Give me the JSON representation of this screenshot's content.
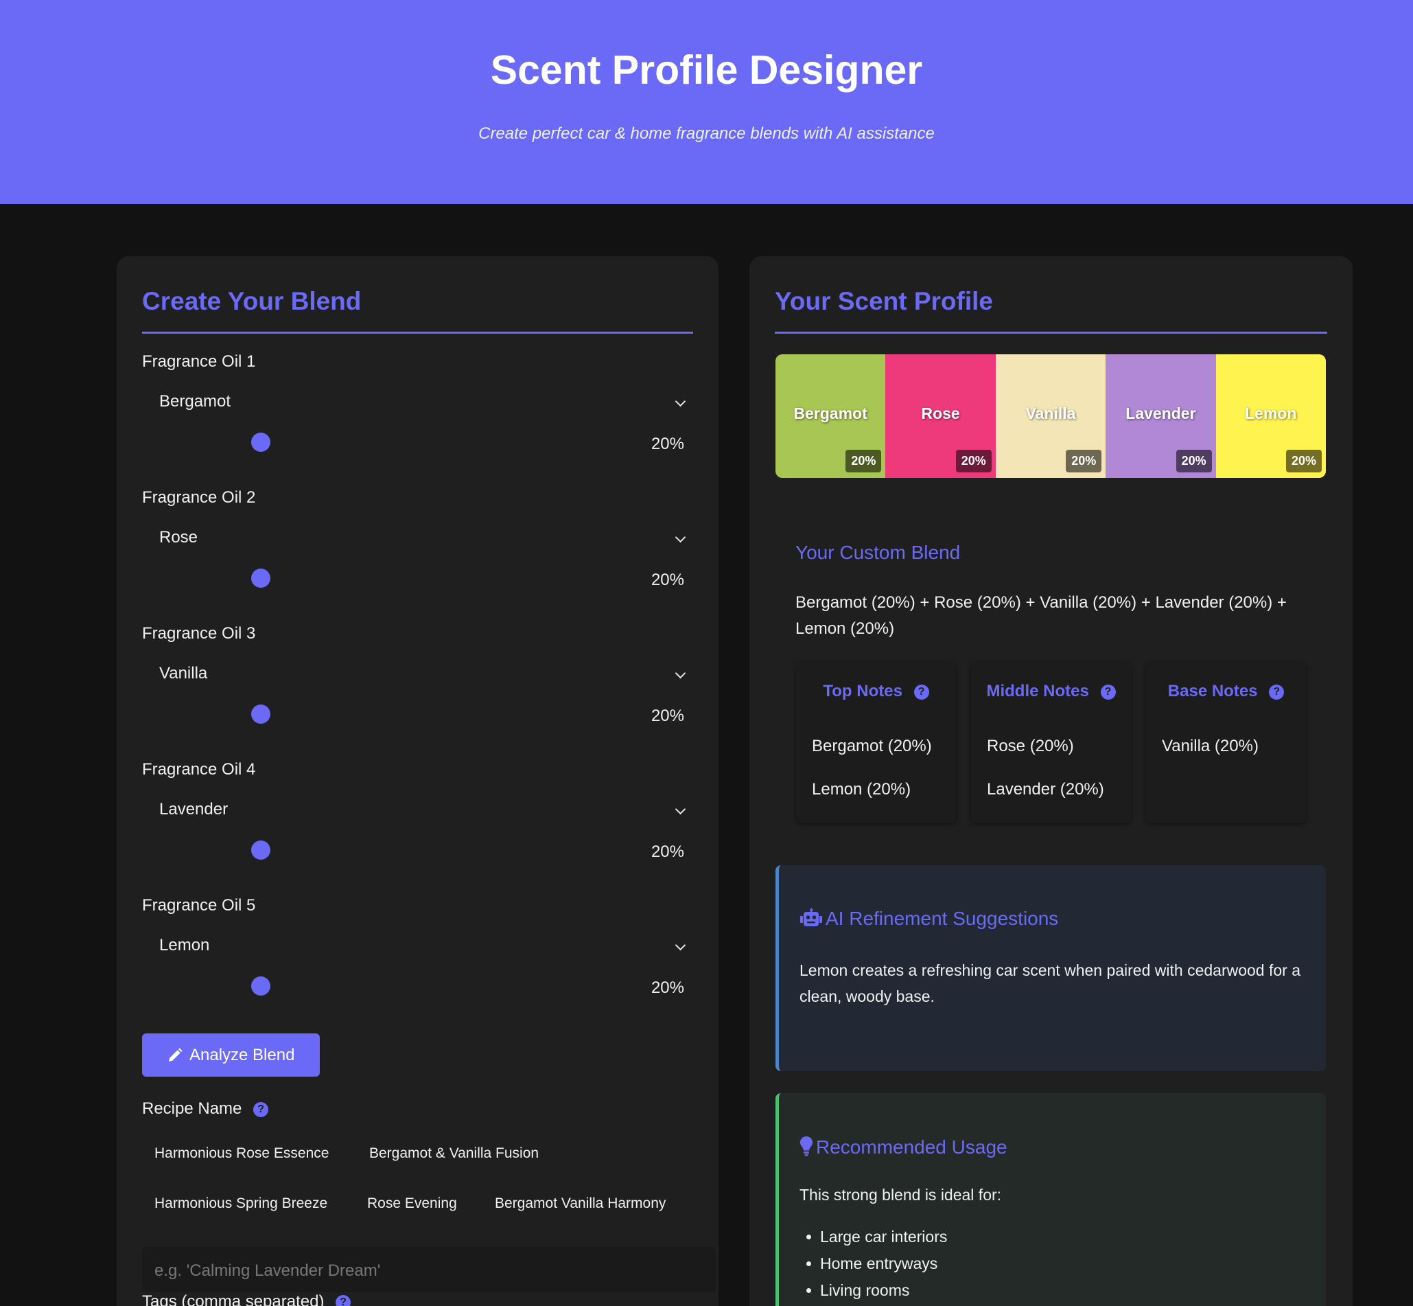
{
  "header": {
    "title": "Scent Profile Designer",
    "subtitle": "Create perfect car & home fragrance blends with AI assistance"
  },
  "colors": {
    "accent": "#6a6af6",
    "background": "#121212",
    "panel": "#1f1f1f"
  },
  "create_blend": {
    "title": "Create Your Blend",
    "oils": [
      {
        "label": "Fragrance Oil 1",
        "selected": "Bergamot",
        "percent_text": "20%",
        "slider_fraction": 0.2
      },
      {
        "label": "Fragrance Oil 2",
        "selected": "Rose",
        "percent_text": "20%",
        "slider_fraction": 0.2
      },
      {
        "label": "Fragrance Oil 3",
        "selected": "Vanilla",
        "percent_text": "20%",
        "slider_fraction": 0.2
      },
      {
        "label": "Fragrance Oil 4",
        "selected": "Lavender",
        "percent_text": "20%",
        "slider_fraction": 0.2
      },
      {
        "label": "Fragrance Oil 5",
        "selected": "Lemon",
        "percent_text": "20%",
        "slider_fraction": 0.2
      }
    ],
    "analyze_button": "Analyze Blend",
    "analyze_icon": "pencil-icon",
    "recipe_label": "Recipe Name",
    "help_glyph": "?",
    "recipe_suggestions": [
      "Harmonious Rose Essence",
      "Bergamot & Vanilla Fusion",
      "Harmonious Spring Breeze",
      "Rose Evening",
      "Bergamot Vanilla Harmony"
    ],
    "recipe_placeholder": "e.g. 'Calming Lavender Dream'",
    "tags_label": "Tags (comma separated)"
  },
  "scent_profile": {
    "title": "Your Scent Profile",
    "segments": [
      {
        "name": "Bergamot",
        "percent": "20%",
        "color": "#a8c653"
      },
      {
        "name": "Rose",
        "percent": "20%",
        "color": "#ee3a7b"
      },
      {
        "name": "Vanilla",
        "percent": "20%",
        "color": "#f3e5b5"
      },
      {
        "name": "Lavender",
        "percent": "20%",
        "color": "#b088d6"
      },
      {
        "name": "Lemon",
        "percent": "20%",
        "color": "#fff350"
      }
    ],
    "custom_blend_title": "Your Custom Blend",
    "custom_blend_text": "Bergamot (20%) + Rose (20%) + Vanilla (20%) + Lavender (20%) + Lemon (20%)",
    "notes": [
      {
        "heading": "Top Notes",
        "items": [
          "Bergamot (20%)",
          "Lemon (20%)"
        ]
      },
      {
        "heading": "Middle Notes",
        "items": [
          "Rose (20%)",
          "Lavender (20%)"
        ]
      },
      {
        "heading": "Base Notes",
        "items": [
          "Vanilla (20%)"
        ]
      }
    ],
    "ai": {
      "icon": "robot-icon",
      "title": "AI Refinement Suggestions",
      "text": "Lemon creates a refreshing car scent when paired with cedarwood for a clean, woody base.",
      "border_color": "#4c84c8"
    },
    "usage": {
      "icon": "lightbulb-icon",
      "title": "Recommended Usage",
      "intro": "This strong blend is ideal for:",
      "items": [
        "Large car interiors",
        "Home entryways",
        "Living rooms"
      ],
      "border_color": "#4ebf6e"
    }
  }
}
